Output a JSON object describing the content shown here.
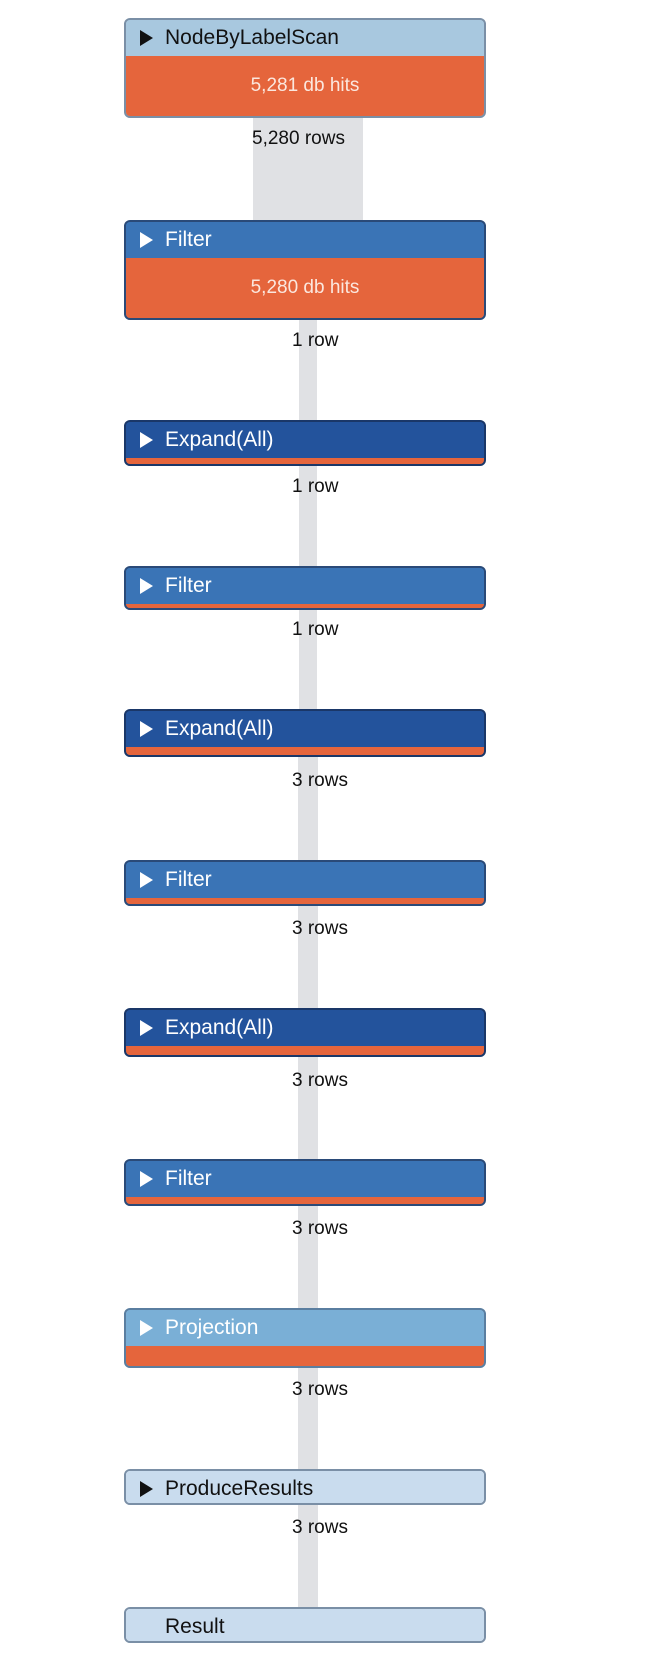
{
  "plan": {
    "operators": [
      {
        "name": "NodeByLabelScan",
        "db_hits": "5,281 db hits",
        "rows_out": "5,280 rows",
        "rows_out_count": 5280,
        "header_color": "#a8c8df",
        "text_color": "#111111",
        "border_color": "#7a8fa6",
        "expandable": true
      },
      {
        "name": "Filter",
        "db_hits": "5,280 db hits",
        "rows_out": "1 row",
        "rows_out_count": 1,
        "header_color": "#3a74b6",
        "text_color": "#ffffff",
        "border_color": "#2a4a78",
        "expandable": true
      },
      {
        "name": "Expand(All)",
        "db_hits": "",
        "rows_out": "1 row",
        "rows_out_count": 1,
        "header_color": "#23539c",
        "text_color": "#ffffff",
        "border_color": "#1a3768",
        "expandable": true
      },
      {
        "name": "Filter",
        "db_hits": "",
        "rows_out": "1 row",
        "rows_out_count": 1,
        "header_color": "#3a74b6",
        "text_color": "#ffffff",
        "border_color": "#2a4a78",
        "expandable": true
      },
      {
        "name": "Expand(All)",
        "db_hits": "",
        "rows_out": "3 rows",
        "rows_out_count": 3,
        "header_color": "#23539c",
        "text_color": "#ffffff",
        "border_color": "#1a3768",
        "expandable": true
      },
      {
        "name": "Filter",
        "db_hits": "",
        "rows_out": "3 rows",
        "rows_out_count": 3,
        "header_color": "#3a74b6",
        "text_color": "#ffffff",
        "border_color": "#2a4a78",
        "expandable": true
      },
      {
        "name": "Expand(All)",
        "db_hits": "",
        "rows_out": "3 rows",
        "rows_out_count": 3,
        "header_color": "#23539c",
        "text_color": "#ffffff",
        "border_color": "#1a3768",
        "expandable": true
      },
      {
        "name": "Filter",
        "db_hits": "",
        "rows_out": "3 rows",
        "rows_out_count": 3,
        "header_color": "#3a74b6",
        "text_color": "#ffffff",
        "border_color": "#2a4a78",
        "expandable": true
      },
      {
        "name": "Projection",
        "db_hits": "",
        "rows_out": "3 rows",
        "rows_out_count": 3,
        "header_color": "#7aafd6",
        "text_color": "#ffffff",
        "border_color": "#5a7ea0",
        "expandable": true
      },
      {
        "name": "ProduceResults",
        "db_hits": "",
        "rows_out": "3 rows",
        "rows_out_count": 3,
        "header_color": "#c9dcee",
        "text_color": "#111111",
        "border_color": "#7a8fa6",
        "expandable": true
      },
      {
        "name": "Result",
        "db_hits": "",
        "rows_out": "",
        "rows_out_count": 0,
        "header_color": "#c9dcee",
        "text_color": "#111111",
        "border_color": "#7a8fa6",
        "expandable": false
      }
    ],
    "hits_color": "#e5653c"
  }
}
